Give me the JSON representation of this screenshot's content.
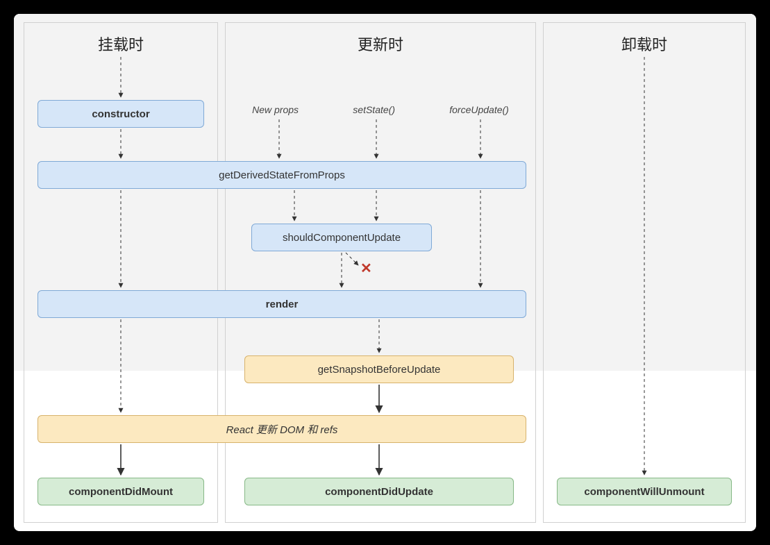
{
  "columns": {
    "mount": {
      "title": "挂载时"
    },
    "update": {
      "title": "更新时"
    },
    "unmount": {
      "title": "卸载时"
    }
  },
  "triggers": {
    "newProps": "New props",
    "setState": "setState()",
    "forceUpdate": "forceUpdate()"
  },
  "nodes": {
    "constructor": "constructor",
    "getDerived": "getDerivedStateFromProps",
    "shouldUpdate": "shouldComponentUpdate",
    "render": "render",
    "getSnapshot": "getSnapshotBeforeUpdate",
    "reactUpdateDom": "React 更新 DOM 和 refs",
    "didMount": "componentDidMount",
    "didUpdate": "componentDidUpdate",
    "willUnmount": "componentWillUnmount"
  },
  "marks": {
    "x": "✕"
  }
}
